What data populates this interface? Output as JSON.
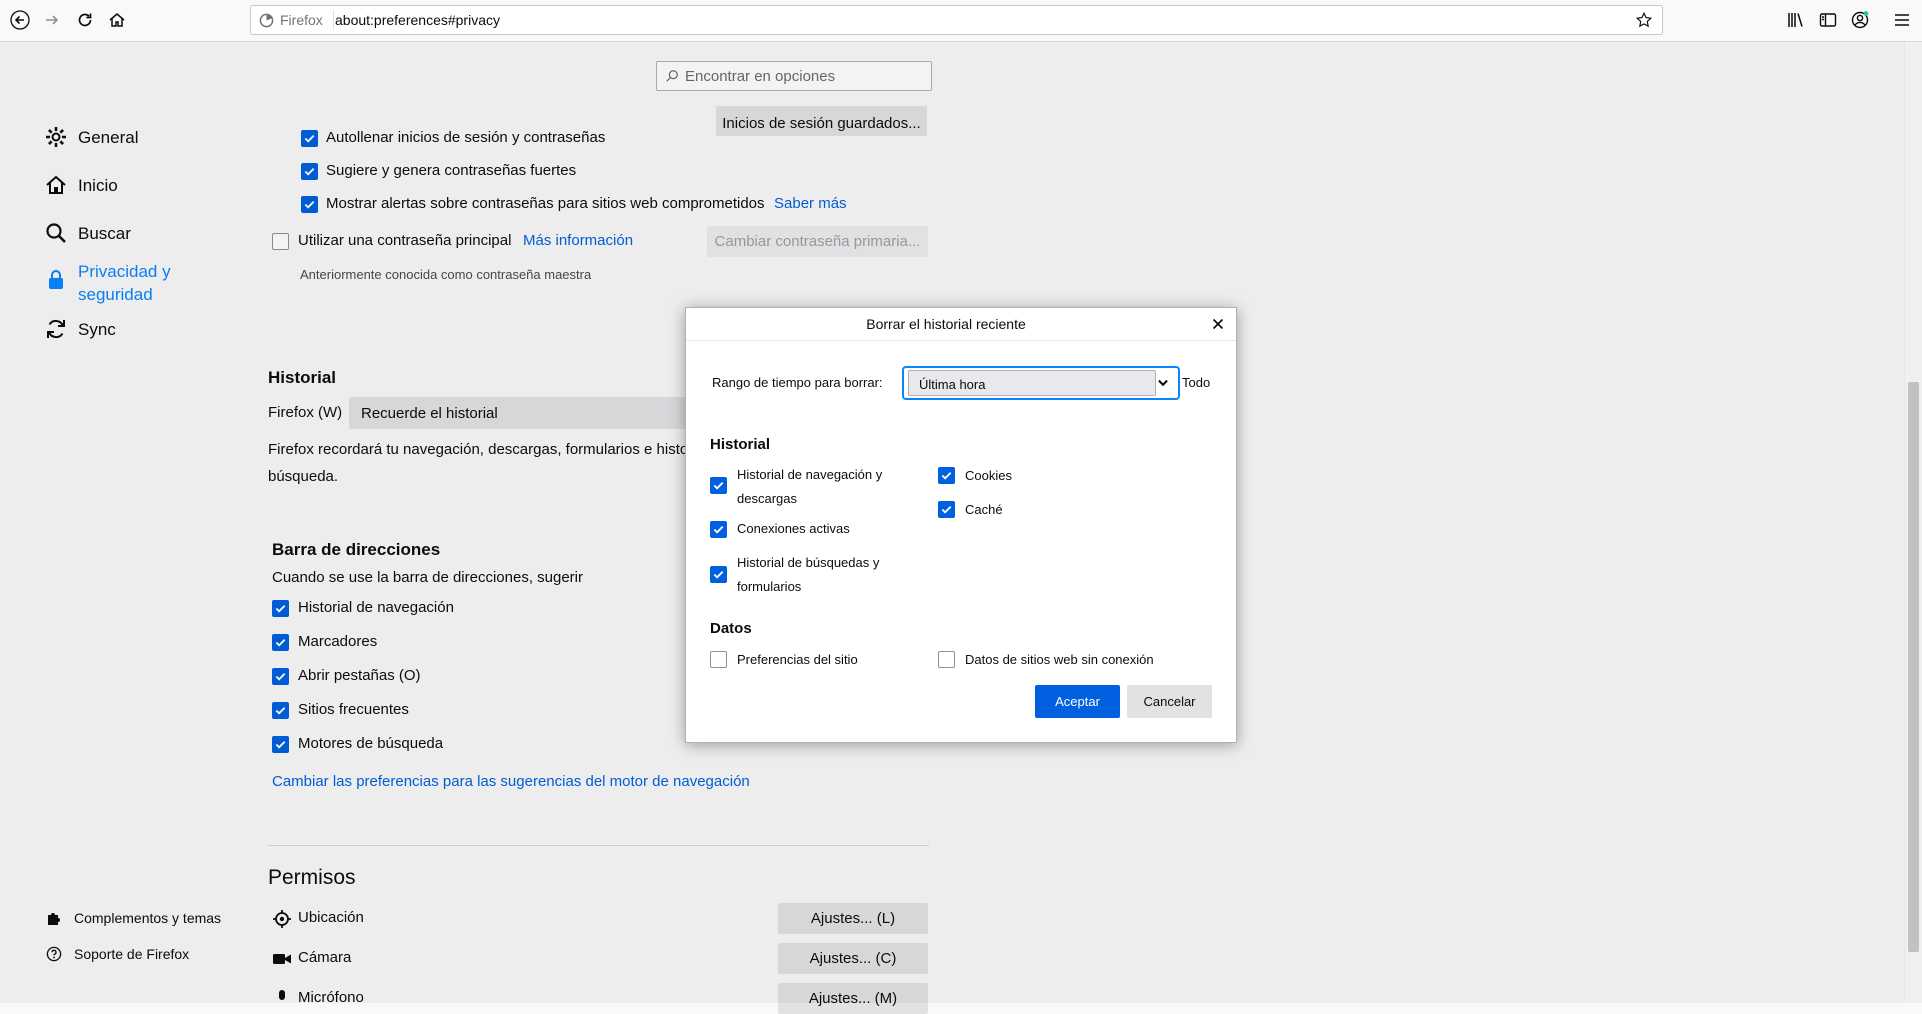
{
  "toolbar": {
    "identity_label": "Firefox",
    "url": "about:preferences#privacy",
    "icons": [
      "back-icon",
      "forward-icon",
      "reload-icon",
      "home-icon",
      "star-icon",
      "library-icon",
      "sidebar-icon",
      "account-icon",
      "menu-icon"
    ]
  },
  "search": {
    "placeholder": "Encontrar en opciones"
  },
  "categories": [
    {
      "label": "General",
      "icon": "gear-icon"
    },
    {
      "label": "Inicio",
      "icon": "home-icon"
    },
    {
      "label": "Buscar",
      "icon": "search-icon"
    },
    {
      "label": "Privacidad y seguridad",
      "label_line1": "Privacidad y",
      "label_line2": "seguridad",
      "icon": "lock-icon",
      "selected": true
    },
    {
      "label": "Sync",
      "icon": "sync-icon"
    }
  ],
  "footer": {
    "addons": "Complementos y temas",
    "support": "Soporte de Firefox"
  },
  "logins": {
    "saved_logins_button": "Inicios de sesión guardados...",
    "autofill": "Autollenar inicios de sesión y contraseñas",
    "suggest": "Sugiere y genera contraseñas fuertes",
    "alerts": "Mostrar alertas sobre contraseñas para sitios web comprometidos",
    "learn_more": "Saber más",
    "primary_password": "Utilizar una contraseña principal",
    "more_info": "Más información",
    "change_primary": "Cambiar contraseña primaria...",
    "formerly": "Anteriormente conocida como contraseña maestra"
  },
  "history": {
    "heading": "Historial",
    "firefox_will_label": "Firefox (W)",
    "mode_value": "Recuerde el historial",
    "description_line1": "Firefox recordará tu navegación, descargas, formularios e histor",
    "description_line2": "búsqueda."
  },
  "address_bar": {
    "heading": "Barra de direcciones",
    "subtitle": "Cuando se use la barra de direcciones, sugerir",
    "items": [
      {
        "label": "Historial de navegación",
        "checked": true
      },
      {
        "label": "Marcadores",
        "checked": true
      },
      {
        "label": "Abrir pestañas (O)",
        "checked": true
      },
      {
        "label": "Sitios frecuentes",
        "checked": true
      },
      {
        "label": "Motores de búsqueda",
        "checked": true
      }
    ],
    "change_link": "Cambiar las preferencias para las sugerencias del motor de navegación"
  },
  "permissions": {
    "heading": "Permisos",
    "items": [
      {
        "label": "Ubicación",
        "icon": "location-icon",
        "button": "Ajustes... (L)"
      },
      {
        "label": "Cámara",
        "icon": "camera-icon",
        "button": "Ajustes... (C)"
      },
      {
        "label": "Micrófono",
        "icon": "microphone-icon",
        "button": "Ajustes... (M)"
      }
    ]
  },
  "dialog": {
    "title": "Borrar el historial reciente",
    "range_label": "Rango de tiempo para borrar:",
    "range_value": "Última hora",
    "range_trailing": "Todo",
    "history_heading": "Historial",
    "history_items": [
      {
        "label": "Historial de navegación y descargas",
        "line1": "Historial de navegación y",
        "line2": "descargas",
        "checked": true
      },
      {
        "label": "Conexiones activas",
        "checked": true
      },
      {
        "label": "Historial de búsquedas y formularios",
        "line1": "Historial de búsquedas y",
        "line2": "formularios",
        "checked": true
      },
      {
        "label": "Cookies",
        "checked": true
      },
      {
        "label": "Caché",
        "checked": true
      }
    ],
    "data_heading": "Datos",
    "data_items": [
      {
        "label": "Preferencias del sitio",
        "checked": false
      },
      {
        "label": "Datos de sitios web sin conexión",
        "checked": false
      }
    ],
    "ok": "Aceptar",
    "cancel": "Cancelar"
  },
  "colors": {
    "accent": "#0060df",
    "focus": "#0a84ff",
    "link": "#0060df"
  }
}
